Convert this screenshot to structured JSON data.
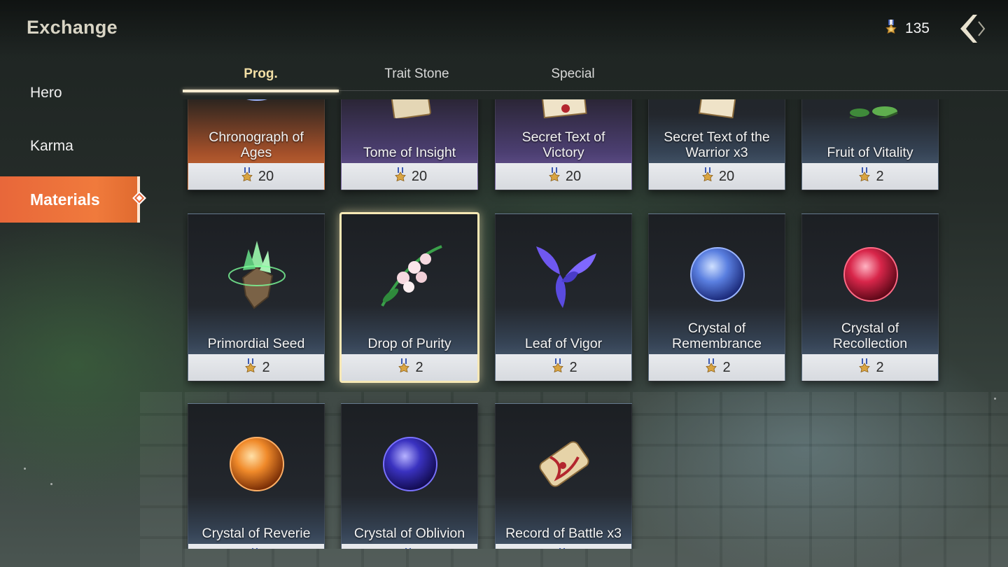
{
  "header": {
    "title": "Exchange",
    "currency_value": "135",
    "currency_icon": "medal-icon",
    "back_icon": "back-arrow-icon"
  },
  "sidebar": {
    "items": [
      {
        "label": "Hero",
        "active": false
      },
      {
        "label": "Karma",
        "active": false
      },
      {
        "label": "Materials",
        "active": true
      }
    ]
  },
  "tabs": [
    {
      "label": "Prog.",
      "active": true
    },
    {
      "label": "Trait Stone",
      "active": false
    },
    {
      "label": "Special",
      "active": false
    }
  ],
  "items": [
    {
      "name": "Chronograph of Ages",
      "price": "20",
      "icon": "hourglass-icon",
      "tint": "orange"
    },
    {
      "name": "Tome of Insight",
      "price": "20",
      "icon": "tome-icon",
      "tint": "purple"
    },
    {
      "name": "Secret Text of Victory",
      "price": "20",
      "icon": "sealed-letter-icon",
      "tint": "purple"
    },
    {
      "name": "Secret Text of the Warrior x3",
      "price": "20",
      "icon": "letter-icon",
      "tint": "blue"
    },
    {
      "name": "Fruit of Vitality",
      "price": "2",
      "icon": "leaf-branch-icon",
      "tint": "blue"
    },
    {
      "name": "Primordial Seed",
      "price": "2",
      "icon": "seed-crystal-icon",
      "tint": "blue"
    },
    {
      "name": "Drop of Purity",
      "price": "2",
      "icon": "lily-of-valley-icon",
      "tint": "blue",
      "selected": true
    },
    {
      "name": "Leaf of Vigor",
      "price": "2",
      "icon": "purple-leaf-icon",
      "tint": "blue"
    },
    {
      "name": "Crystal of Remembrance",
      "price": "2",
      "icon": "blue-orb-icon",
      "tint": "blue"
    },
    {
      "name": "Crystal of Recollection",
      "price": "2",
      "icon": "red-orb-icon",
      "tint": "blue"
    },
    {
      "name": "Crystal of Reverie",
      "price": "",
      "icon": "orange-orb-icon",
      "tint": "blue"
    },
    {
      "name": "Crystal of Oblivion",
      "price": "",
      "icon": "dark-blue-orb-icon",
      "tint": "blue"
    },
    {
      "name": "Record of Battle x3",
      "price": "",
      "icon": "scroll-icon",
      "tint": "blue"
    }
  ],
  "colors": {
    "accent_orange": "#e8673a",
    "tab_active": "#f3dfa5",
    "selected_border": "#f7e8b5"
  }
}
